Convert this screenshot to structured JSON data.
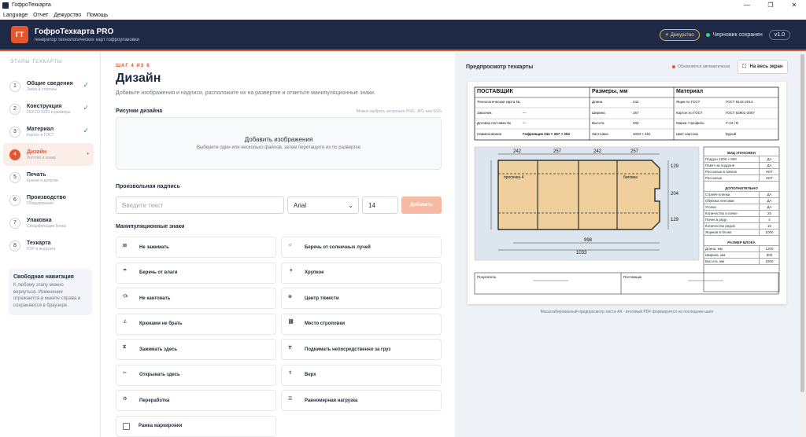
{
  "window": {
    "title": "ГофроТехкарта",
    "controls": [
      "—",
      "❐",
      "✕"
    ]
  },
  "menu": [
    "Language",
    "Отчет",
    "Дежурство",
    "Помощь"
  ],
  "header": {
    "logo": "ГТ",
    "title": "ГофроТехкарта PRO",
    "subtitle": "генератор технологических карт гофроупаковки",
    "duty_button": "☀ Дежурство",
    "status": "Черновик сохранен",
    "version": "v1.0",
    "colors": {
      "bg": "#1e2a45",
      "accent": "#e4572e",
      "ok": "#3ccf7e"
    }
  },
  "sidebar": {
    "heading": "ЭТАПЫ ТЕХКАРТЫ",
    "steps": [
      {
        "num": "1",
        "title": "Общие сведения",
        "sub": "Заказ и стороны",
        "mark": "✓"
      },
      {
        "num": "2",
        "title": "Конструкция",
        "sub": "FEFCO 0201 и размеры",
        "mark": "✓"
      },
      {
        "num": "3",
        "title": "Материал",
        "sub": "Картон и ГОСТ",
        "mark": "✓"
      },
      {
        "num": "4",
        "title": "Дизайн",
        "sub": "Логотип и знаки",
        "mark": "•"
      },
      {
        "num": "5",
        "title": "Печать",
        "sub": "Краски и допуски",
        "mark": ""
      },
      {
        "num": "6",
        "title": "Производство",
        "sub": "Оборудование",
        "mark": ""
      },
      {
        "num": "7",
        "title": "Упаковка",
        "sub": "Спецификация блока",
        "mark": ""
      },
      {
        "num": "8",
        "title": "Техкарта",
        "sub": "PDF и выгрузка",
        "mark": ""
      }
    ],
    "nav_card": {
      "title": "Свободная навигация",
      "text": "К любому этапу можно вернуться. Изменения отражаются в макете справа и сохраняются в браузере."
    }
  },
  "main": {
    "step_label": "ШАГ 4 ИЗ 8",
    "title": "Дизайн",
    "description": "Добавьте изображения и надписи, расположите их на развертке и отметьте манипуляционные знаки.",
    "images_section": {
      "title": "Рисунки дизайна",
      "hint": "Можно выбрать несколько PNG, JPG или SVG",
      "upload_title": "Добавить изображения",
      "upload_text": "Выберите один или несколько файлов, затем перетащите их по развертке"
    },
    "custom_text": {
      "title": "Произвольная надпись",
      "placeholder": "Введите текст",
      "font": "Arial",
      "size": "14",
      "add_button": "Добавить"
    },
    "signs": {
      "title": "Манипуляционные знаки",
      "items": [
        {
          "label": "Не зажимать",
          "icon": "no-clamp-icon",
          "glyph": "⊠"
        },
        {
          "label": "Беречь от солнечных лучей",
          "icon": "sun-protect-icon",
          "glyph": "☼"
        },
        {
          "label": "Беречь от влаги",
          "icon": "umbrella-icon",
          "glyph": "☂"
        },
        {
          "label": "Хрупкое",
          "icon": "fragile-glass-icon",
          "glyph": "🍷"
        },
        {
          "label": "Не кантовать",
          "icon": "no-tilt-icon",
          "glyph": "⤼"
        },
        {
          "label": "Центр тяжести",
          "icon": "center-gravity-icon",
          "glyph": "⊕"
        },
        {
          "label": "Крюками не брать",
          "icon": "no-hooks-icon",
          "glyph": "⚓"
        },
        {
          "label": "Место строповки",
          "icon": "sling-point-icon",
          "glyph": "⛓"
        },
        {
          "label": "Зажимать здесь",
          "icon": "clamp-here-icon",
          "glyph": "⧖"
        },
        {
          "label": "Поднимать непосредственно за груз",
          "icon": "lift-icon",
          "glyph": "⇈"
        },
        {
          "label": "Открывать здесь",
          "icon": "open-here-icon",
          "glyph": "✂"
        },
        {
          "label": "Верх",
          "icon": "this-way-up-icon",
          "glyph": "⇑"
        },
        {
          "label": "Переработка",
          "icon": "recycle-icon",
          "glyph": "♻"
        },
        {
          "label": "Равномерная нагрузка",
          "icon": "even-load-icon",
          "glyph": "☰"
        },
        {
          "label": "Рамка маркировки",
          "icon": "marking-frame-icon",
          "glyph": ""
        }
      ]
    }
  },
  "preview": {
    "title": "Предпросмотр техкарты",
    "auto_update": "Обновляется автоматически",
    "fullscreen_button": "На весь экран",
    "caption": "Масштабированный предпросмотр листа A4 · итоговый PDF формируется на последнем шаге",
    "sheet": {
      "supplier": {
        "title": "ПОСТАВЩИК",
        "rows": [
          [
            "Технологическая карта №",
            ""
          ],
          [
            "Заказчик",
            "—"
          ],
          [
            "Договор поставки №",
            "—"
          ],
          [
            "Наименование",
            "Гофроящик 242 × 257 × 204"
          ]
        ]
      },
      "sizes": {
        "title": "Размеры, мм",
        "rows": [
          [
            "Длина",
            "242"
          ],
          [
            "Ширина",
            "257"
          ],
          [
            "Высота",
            "204"
          ],
          [
            "Заготовка",
            "1033 × 461"
          ]
        ]
      },
      "material": {
        "title": "Материал",
        "rows": [
          [
            "Ящик по ГОСТ",
            "ГОСТ 9142-2014"
          ],
          [
            "Картон по ГОСТ",
            "ГОСТ 52901-2007"
          ],
          [
            "Марка / профиль",
            "Т-24 / В"
          ],
          [
            "Цвет картона",
            "Бурый"
          ]
        ]
      },
      "blank": {
        "top_dims": [
          "242",
          "257",
          "242",
          "257"
        ],
        "side_dims": [
          "129",
          "204",
          "129"
        ],
        "bottom_dims": [
          "998",
          "1033"
        ],
        "labels": [
          "просечка 4",
          "биговка"
        ]
      },
      "packing": {
        "title": "ВИД УПАКОВКИ",
        "rows": [
          [
            "Поддон 1200 × 800",
            "ДА"
          ],
          [
            "Пакет на поддоне",
            "ДА"
          ],
          [
            "Россыпью в пачках",
            "НЕТ"
          ],
          [
            "Россыпью",
            "НЕТ"
          ]
        ],
        "extra_title": "ДОПОЛНИТЕЛЬНО",
        "extra_rows": [
          [
            "Стрейч-пленка",
            "ДА"
          ],
          [
            "Обвязка лентами",
            "ДА"
          ],
          [
            "Уголки",
            "ДА"
          ],
          [
            "Количество в пачке",
            "25"
          ],
          [
            "Пачек в ряду",
            "4"
          ],
          [
            "Количество рядов",
            "10"
          ],
          [
            "Ящиков в блоке",
            "1000"
          ]
        ],
        "block_title": "РАЗМЕР БЛОКА",
        "block_rows": [
          [
            "Длина, мм",
            "1200"
          ],
          [
            "Ширина, мм",
            "800"
          ],
          [
            "Высота, мм",
            "1800"
          ]
        ]
      },
      "signatures": {
        "buyer": "Покупатель",
        "supplier": "Поставщик"
      }
    }
  }
}
